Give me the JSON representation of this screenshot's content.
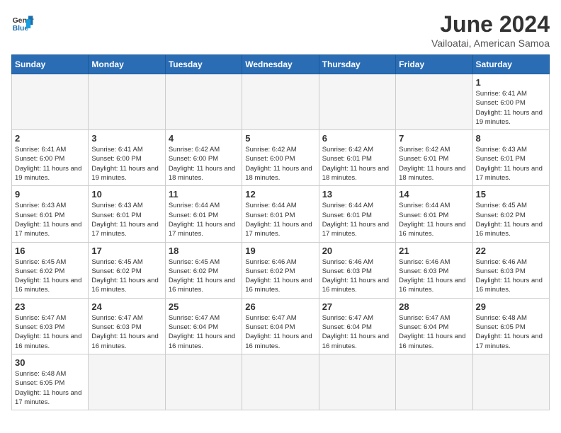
{
  "logo": {
    "text_general": "General",
    "text_blue": "Blue"
  },
  "title": {
    "month_year": "June 2024",
    "location": "Vailoatai, American Samoa"
  },
  "weekdays": [
    "Sunday",
    "Monday",
    "Tuesday",
    "Wednesday",
    "Thursday",
    "Friday",
    "Saturday"
  ],
  "weeks": [
    [
      {
        "day": "",
        "info": ""
      },
      {
        "day": "",
        "info": ""
      },
      {
        "day": "",
        "info": ""
      },
      {
        "day": "",
        "info": ""
      },
      {
        "day": "",
        "info": ""
      },
      {
        "day": "",
        "info": ""
      },
      {
        "day": "1",
        "info": "Sunrise: 6:41 AM\nSunset: 6:00 PM\nDaylight: 11 hours and 19 minutes."
      }
    ],
    [
      {
        "day": "2",
        "info": "Sunrise: 6:41 AM\nSunset: 6:00 PM\nDaylight: 11 hours and 19 minutes."
      },
      {
        "day": "3",
        "info": "Sunrise: 6:41 AM\nSunset: 6:00 PM\nDaylight: 11 hours and 19 minutes."
      },
      {
        "day": "4",
        "info": "Sunrise: 6:42 AM\nSunset: 6:00 PM\nDaylight: 11 hours and 18 minutes."
      },
      {
        "day": "5",
        "info": "Sunrise: 6:42 AM\nSunset: 6:00 PM\nDaylight: 11 hours and 18 minutes."
      },
      {
        "day": "6",
        "info": "Sunrise: 6:42 AM\nSunset: 6:01 PM\nDaylight: 11 hours and 18 minutes."
      },
      {
        "day": "7",
        "info": "Sunrise: 6:42 AM\nSunset: 6:01 PM\nDaylight: 11 hours and 18 minutes."
      },
      {
        "day": "8",
        "info": "Sunrise: 6:43 AM\nSunset: 6:01 PM\nDaylight: 11 hours and 17 minutes."
      }
    ],
    [
      {
        "day": "9",
        "info": "Sunrise: 6:43 AM\nSunset: 6:01 PM\nDaylight: 11 hours and 17 minutes."
      },
      {
        "day": "10",
        "info": "Sunrise: 6:43 AM\nSunset: 6:01 PM\nDaylight: 11 hours and 17 minutes."
      },
      {
        "day": "11",
        "info": "Sunrise: 6:44 AM\nSunset: 6:01 PM\nDaylight: 11 hours and 17 minutes."
      },
      {
        "day": "12",
        "info": "Sunrise: 6:44 AM\nSunset: 6:01 PM\nDaylight: 11 hours and 17 minutes."
      },
      {
        "day": "13",
        "info": "Sunrise: 6:44 AM\nSunset: 6:01 PM\nDaylight: 11 hours and 17 minutes."
      },
      {
        "day": "14",
        "info": "Sunrise: 6:44 AM\nSunset: 6:01 PM\nDaylight: 11 hours and 16 minutes."
      },
      {
        "day": "15",
        "info": "Sunrise: 6:45 AM\nSunset: 6:02 PM\nDaylight: 11 hours and 16 minutes."
      }
    ],
    [
      {
        "day": "16",
        "info": "Sunrise: 6:45 AM\nSunset: 6:02 PM\nDaylight: 11 hours and 16 minutes."
      },
      {
        "day": "17",
        "info": "Sunrise: 6:45 AM\nSunset: 6:02 PM\nDaylight: 11 hours and 16 minutes."
      },
      {
        "day": "18",
        "info": "Sunrise: 6:45 AM\nSunset: 6:02 PM\nDaylight: 11 hours and 16 minutes."
      },
      {
        "day": "19",
        "info": "Sunrise: 6:46 AM\nSunset: 6:02 PM\nDaylight: 11 hours and 16 minutes."
      },
      {
        "day": "20",
        "info": "Sunrise: 6:46 AM\nSunset: 6:03 PM\nDaylight: 11 hours and 16 minutes."
      },
      {
        "day": "21",
        "info": "Sunrise: 6:46 AM\nSunset: 6:03 PM\nDaylight: 11 hours and 16 minutes."
      },
      {
        "day": "22",
        "info": "Sunrise: 6:46 AM\nSunset: 6:03 PM\nDaylight: 11 hours and 16 minutes."
      }
    ],
    [
      {
        "day": "23",
        "info": "Sunrise: 6:47 AM\nSunset: 6:03 PM\nDaylight: 11 hours and 16 minutes."
      },
      {
        "day": "24",
        "info": "Sunrise: 6:47 AM\nSunset: 6:03 PM\nDaylight: 11 hours and 16 minutes."
      },
      {
        "day": "25",
        "info": "Sunrise: 6:47 AM\nSunset: 6:04 PM\nDaylight: 11 hours and 16 minutes."
      },
      {
        "day": "26",
        "info": "Sunrise: 6:47 AM\nSunset: 6:04 PM\nDaylight: 11 hours and 16 minutes."
      },
      {
        "day": "27",
        "info": "Sunrise: 6:47 AM\nSunset: 6:04 PM\nDaylight: 11 hours and 16 minutes."
      },
      {
        "day": "28",
        "info": "Sunrise: 6:47 AM\nSunset: 6:04 PM\nDaylight: 11 hours and 16 minutes."
      },
      {
        "day": "29",
        "info": "Sunrise: 6:48 AM\nSunset: 6:05 PM\nDaylight: 11 hours and 17 minutes."
      }
    ],
    [
      {
        "day": "30",
        "info": "Sunrise: 6:48 AM\nSunset: 6:05 PM\nDaylight: 11 hours and 17 minutes."
      },
      {
        "day": "",
        "info": ""
      },
      {
        "day": "",
        "info": ""
      },
      {
        "day": "",
        "info": ""
      },
      {
        "day": "",
        "info": ""
      },
      {
        "day": "",
        "info": ""
      },
      {
        "day": "",
        "info": ""
      }
    ]
  ]
}
